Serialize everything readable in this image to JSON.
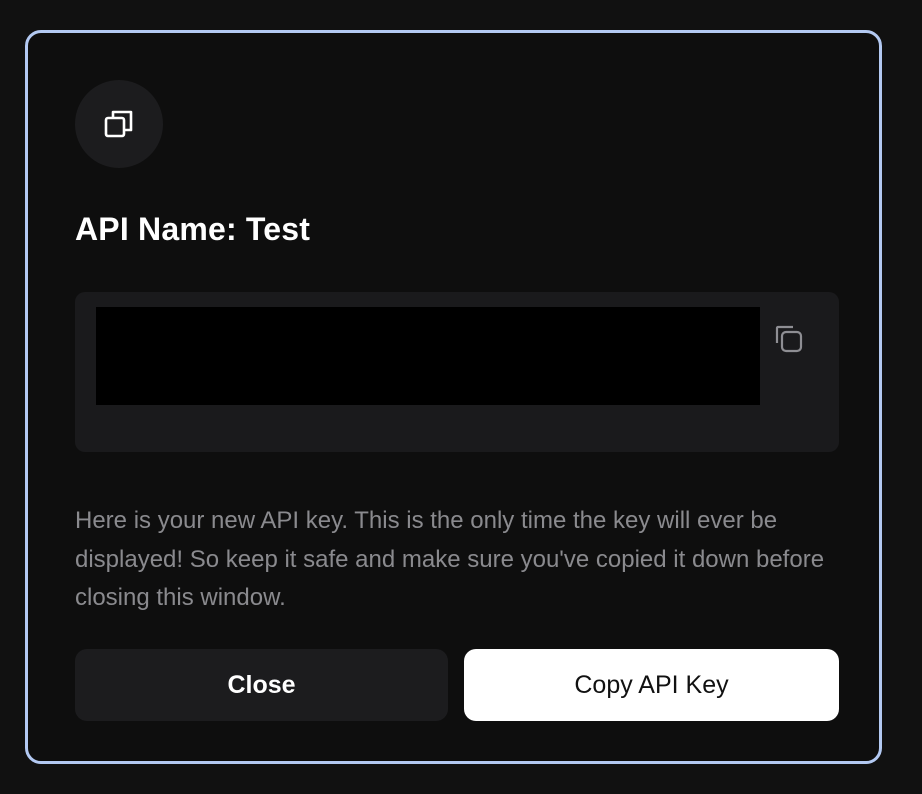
{
  "modal": {
    "header_icon": "copy-icon",
    "title": "API Name: Test",
    "key_field": {
      "value_redacted": true,
      "copy_icon": "copy-icon"
    },
    "description": "Here is your new API key. This is the only time the key will ever be displayed! So keep it safe and make sure you've copied it down before closing this window.",
    "buttons": {
      "close_label": "Close",
      "copy_label": "Copy API Key"
    }
  },
  "colors": {
    "accent_border": "#b3c9f2",
    "background": "#0e0e0e",
    "surface": "#1c1c1e",
    "muted_text": "#8a8a8e",
    "primary_button_bg": "#ffffff"
  }
}
